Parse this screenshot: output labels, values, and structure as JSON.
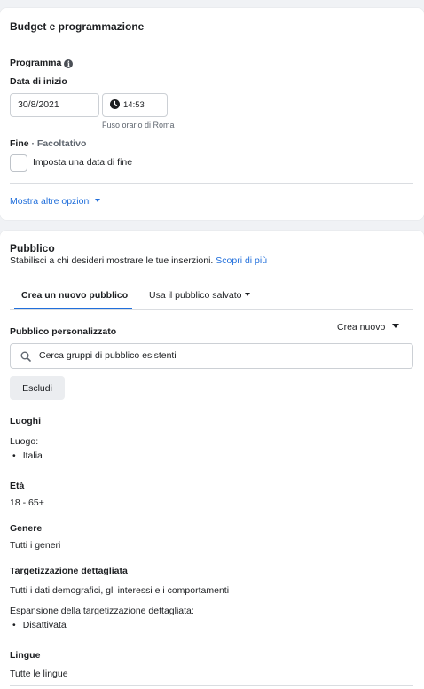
{
  "budget": {
    "title": "Budget e programmazione",
    "schedule_label": "Programma",
    "start_date_label": "Data di inizio",
    "start_date_value": "30/8/2021",
    "start_time_value": "14:53",
    "timezone_note": "Fuso orario di Roma",
    "end_label": "Fine",
    "end_optional": "· Facoltativo",
    "end_checkbox_label": "Imposta una data di fine",
    "more_options": "Mostra altre opzioni"
  },
  "audience": {
    "title": "Pubblico",
    "subtitle": "Stabilisci a chi desideri mostrare le tue inserzioni.",
    "learn_more": "Scopri di più",
    "tabs": [
      {
        "label": "Crea un nuovo pubblico",
        "active": true
      },
      {
        "label": "Usa il pubblico salvato",
        "active": false
      }
    ],
    "custom_audience_label": "Pubblico personalizzato",
    "create_new_label": "Crea nuovo",
    "search_placeholder": "Cerca gruppi di pubblico esistenti",
    "exclude_button": "Escludi",
    "locations": {
      "heading": "Luoghi",
      "sub": "Luogo:",
      "items": [
        "Italia"
      ]
    },
    "age": {
      "heading": "Età",
      "value": "18 - 65+"
    },
    "gender": {
      "heading": "Genere",
      "value": "Tutti i generi"
    },
    "detailed_targeting": {
      "heading": "Targetizzazione dettagliata",
      "value": "Tutti i dati demografici, gli interessi e i comportamenti",
      "expansion_label": "Espansione della targetizzazione dettagliata:",
      "expansion_items": [
        "Disattivata"
      ]
    },
    "languages": {
      "heading": "Lingue",
      "value": "Tutte le lingue"
    }
  },
  "colors": {
    "link": "#216fdb",
    "background": "#f0f2f5",
    "card": "#ffffff"
  }
}
